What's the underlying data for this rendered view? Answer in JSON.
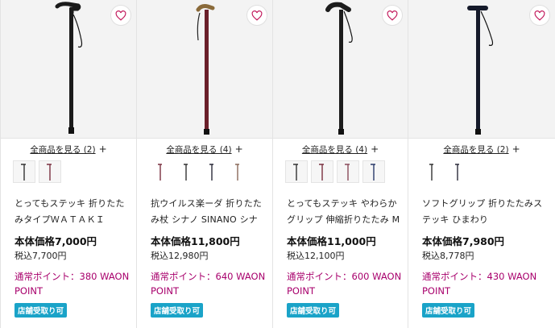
{
  "products": [
    {
      "see_all_label": "全商品を見る (2)",
      "plus_label": "+",
      "name": "とってもステッキ 折りたたみタイプＷＡＴＡＫＩ",
      "price": "本体価格7,000円",
      "tax_price": "税込7,700円",
      "points": "通常ポイント：380 WAON POINT",
      "badge": "店舗受取り可",
      "cane_color": "#1a1a1a",
      "thumb_count": 2
    },
    {
      "see_all_label": "全商品を見る (4)",
      "plus_label": "+",
      "name": "抗ウイルス楽ーダ 折りたたみ杖 シナノ SINANO シナノ",
      "price": "本体価格11,800円",
      "tax_price": "税込12,980円",
      "points": "通常ポイント：640 WAON POINT",
      "badge": "店舗受取り可",
      "cane_color": "#6a1f2a",
      "thumb_count": 4
    },
    {
      "see_all_label": "全商品を見る (4)",
      "plus_label": "+",
      "name": "とってもステッキ やわらかグリップ 伸縮折りたたみ Mサイズ…",
      "price": "本体価格11,000円",
      "tax_price": "税込12,100円",
      "points": "通常ポイント：600 WAON POINT",
      "badge": "店舗受取り可",
      "cane_color": "#1c1c1c",
      "thumb_count": 4
    },
    {
      "see_all_label": "全商品を見る (2)",
      "plus_label": "+",
      "name": "ソフトグリップ 折りたたみステッキ ひまわり",
      "price": "本体価格7,980円",
      "tax_price": "税込8,778円",
      "points": "通常ポイント：430 WAON POINT",
      "badge": "店舗受取り可",
      "cane_color": "#151a2a",
      "thumb_count": 2
    }
  ],
  "colors": {
    "accent_points": "#a8006c",
    "badge_bg": "#1aa3c8",
    "heart": "#c2185b"
  },
  "icons": {
    "favorite": "heart-outline-icon"
  }
}
